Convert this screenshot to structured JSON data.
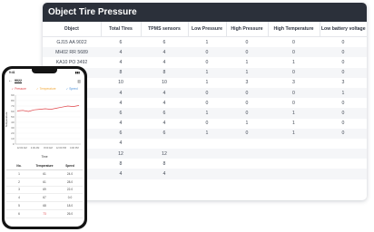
{
  "desktop": {
    "title": "Object Tire Pressure",
    "columns": [
      "Object",
      "Total Tires",
      "TPMS sensors",
      "Low Pressure",
      "High Pressure",
      "High Temperature",
      "Low battery voltage"
    ],
    "rows": [
      [
        "GJ15 AA 9022",
        "6",
        "6",
        "1",
        "0",
        "0",
        "0"
      ],
      [
        "MH02 RR 5689",
        "4",
        "4",
        "0",
        "0",
        "0",
        "0"
      ],
      [
        "KA10 PO 3492",
        "4",
        "4",
        "0",
        "1",
        "1",
        "0"
      ],
      [
        "",
        "8",
        "8",
        "1",
        "1",
        "0",
        "0"
      ],
      [
        "",
        "10",
        "10",
        "1",
        "3",
        "3",
        "3"
      ],
      [
        "",
        "4",
        "4",
        "0",
        "0",
        "0",
        "1"
      ],
      [
        "",
        "4",
        "4",
        "0",
        "0",
        "0",
        "0"
      ],
      [
        "",
        "6",
        "6",
        "1",
        "0",
        "1",
        "0"
      ],
      [
        "",
        "4",
        "4",
        "0",
        "1",
        "1",
        "0"
      ],
      [
        "",
        "6",
        "6",
        "1",
        "0",
        "1",
        "0"
      ],
      [
        "",
        "4",
        "",
        "",
        "",
        "",
        ""
      ],
      [
        "",
        "12",
        "12",
        "",
        "",
        "",
        ""
      ],
      [
        "",
        "8",
        "8",
        "",
        "",
        "",
        ""
      ],
      [
        "",
        "4",
        "4",
        "",
        "",
        "",
        ""
      ]
    ]
  },
  "phone": {
    "status_time": "9:41",
    "status_icons": "▮▮▮",
    "title": "9022",
    "legend": [
      {
        "label": "Pressure",
        "color": "#e0454a"
      },
      {
        "label": "Temperature",
        "color": "#f2a93b"
      },
      {
        "label": "Speed",
        "color": "#4a90d9"
      }
    ],
    "chart_data": {
      "type": "line",
      "xlabel": "Time",
      "ylabel": "Temperature",
      "y_ticks": [
        "90",
        "80",
        "70",
        "60",
        "50",
        "40",
        "30",
        "20",
        "10",
        "0"
      ],
      "x_ticks": [
        "12:00 AM",
        "4:00 AM",
        "8:00 AM",
        "12:00 PM",
        "4:00 PM"
      ],
      "ylim": [
        0,
        90
      ],
      "series": [
        {
          "color": "#e0454a",
          "values": [
            61,
            62,
            60,
            63,
            64,
            65,
            64,
            66,
            68,
            70,
            69,
            71
          ]
        }
      ]
    },
    "table": {
      "headers": [
        "No.",
        "Temperature",
        "Speed"
      ],
      "rows": [
        [
          "1",
          "61",
          "24.0"
        ],
        [
          "2",
          "61",
          "28.0"
        ],
        [
          "3",
          "69",
          "22.0"
        ],
        [
          "4",
          "67",
          "0.0"
        ],
        [
          "5",
          "68",
          "18.0"
        ],
        [
          "6",
          "73",
          "26.0"
        ]
      ]
    }
  }
}
